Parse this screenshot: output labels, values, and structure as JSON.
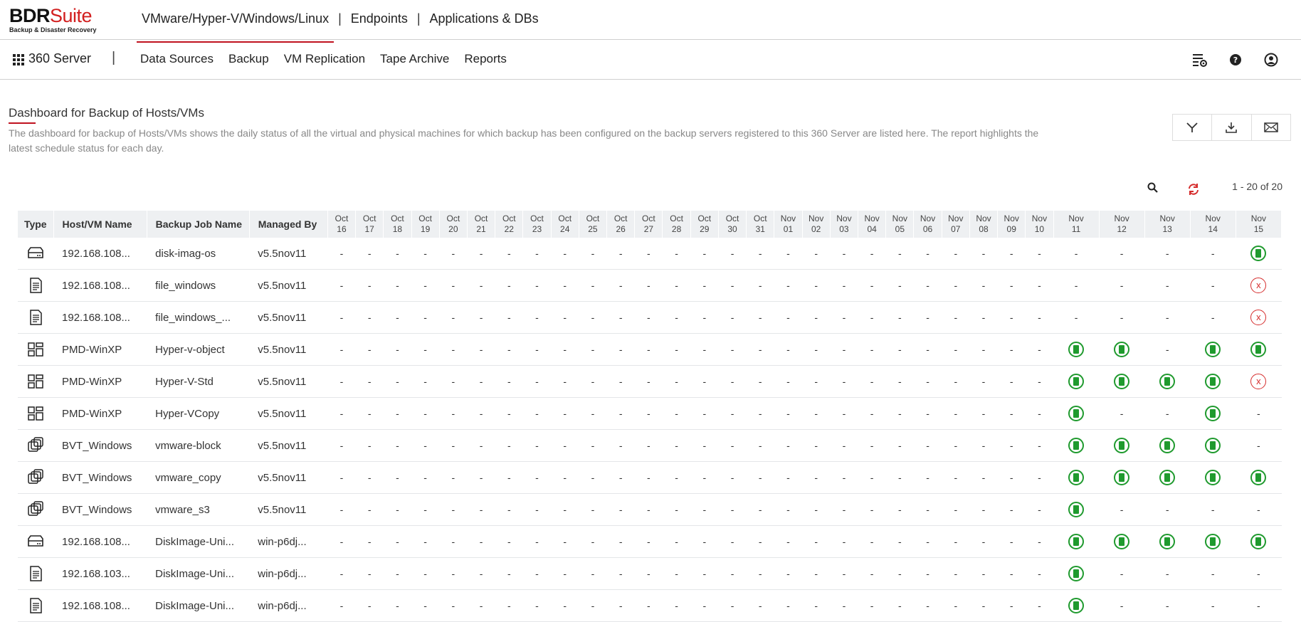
{
  "brand": {
    "name_bold": "BDR",
    "name_accent": "Suite",
    "tagline": "Backup & Disaster Recovery",
    "accent_color": "#c0121f"
  },
  "product_nav": {
    "items": [
      "VMware/Hyper-V/Windows/Linux",
      "Endpoints",
      "Applications & DBs"
    ],
    "active": 0
  },
  "menubar": {
    "product": "360 Server",
    "separator": "|",
    "items": [
      "Data Sources",
      "Backup",
      "VM Replication",
      "Tape Archive",
      "Reports"
    ],
    "icons": [
      "settings-list-icon",
      "help-icon",
      "user-icon"
    ]
  },
  "page": {
    "title": "Dashboard for Backup of Hosts/VMs",
    "description": "The dashboard for backup of Hosts/VMs shows the daily status of all the virtual and physical machines for which backup has been configured on the backup servers registered to this 360 Server are listed here. The report highlights the latest schedule status for each day.",
    "actions": [
      "filter-icon",
      "download-icon",
      "email-icon"
    ],
    "pager": "1 - 20 of 20"
  },
  "status_colors": {
    "success": "#1f9a2e",
    "failed": "#d52b2b"
  },
  "table": {
    "headers": {
      "type": "Type",
      "host": "Host/VM Name",
      "job": "Backup Job Name",
      "managed": "Managed By"
    },
    "dates": [
      [
        "Oct",
        "16"
      ],
      [
        "Oct",
        "17"
      ],
      [
        "Oct",
        "18"
      ],
      [
        "Oct",
        "19"
      ],
      [
        "Oct",
        "20"
      ],
      [
        "Oct",
        "21"
      ],
      [
        "Oct",
        "22"
      ],
      [
        "Oct",
        "23"
      ],
      [
        "Oct",
        "24"
      ],
      [
        "Oct",
        "25"
      ],
      [
        "Oct",
        "26"
      ],
      [
        "Oct",
        "27"
      ],
      [
        "Oct",
        "28"
      ],
      [
        "Oct",
        "29"
      ],
      [
        "Oct",
        "30"
      ],
      [
        "Oct",
        "31"
      ],
      [
        "Nov",
        "01"
      ],
      [
        "Nov",
        "02"
      ],
      [
        "Nov",
        "03"
      ],
      [
        "Nov",
        "04"
      ],
      [
        "Nov",
        "05"
      ],
      [
        "Nov",
        "06"
      ],
      [
        "Nov",
        "07"
      ],
      [
        "Nov",
        "08"
      ],
      [
        "Nov",
        "09"
      ],
      [
        "Nov",
        "10"
      ],
      [
        "Nov",
        "11"
      ],
      [
        "Nov",
        "12"
      ],
      [
        "Nov",
        "13"
      ],
      [
        "Nov",
        "14"
      ],
      [
        "Nov",
        "15"
      ]
    ],
    "rows": [
      {
        "type": "disk",
        "host": "192.168.108...",
        "job": "disk-imag-os",
        "managed": "v5.5nov11",
        "last5": [
          "-",
          "-",
          "-",
          "-",
          "ok"
        ]
      },
      {
        "type": "file",
        "host": "192.168.108...",
        "job": "file_windows",
        "managed": "v5.5nov11",
        "last5": [
          "-",
          "-",
          "-",
          "-",
          "fail"
        ]
      },
      {
        "type": "file",
        "host": "192.168.108...",
        "job": "file_windows_...",
        "managed": "v5.5nov11",
        "last5": [
          "-",
          "-",
          "-",
          "-",
          "fail"
        ]
      },
      {
        "type": "hyperv",
        "host": "PMD-WinXP",
        "job": "Hyper-v-object",
        "managed": "v5.5nov11",
        "last5": [
          "ok",
          "ok",
          "-",
          "ok",
          "ok"
        ]
      },
      {
        "type": "hyperv",
        "host": "PMD-WinXP",
        "job": "Hyper-V-Std",
        "managed": "v5.5nov11",
        "last5": [
          "ok",
          "ok",
          "ok",
          "ok",
          "fail"
        ]
      },
      {
        "type": "hyperv",
        "host": "PMD-WinXP",
        "job": "Hyper-VCopy",
        "managed": "v5.5nov11",
        "last5": [
          "ok",
          "-",
          "-",
          "ok",
          "-"
        ]
      },
      {
        "type": "vmware",
        "host": "BVT_Windows",
        "job": "vmware-block",
        "managed": "v5.5nov11",
        "last5": [
          "ok",
          "ok",
          "ok",
          "ok",
          "-"
        ]
      },
      {
        "type": "vmware",
        "host": "BVT_Windows",
        "job": "vmware_copy",
        "managed": "v5.5nov11",
        "last5": [
          "ok",
          "ok",
          "ok",
          "ok",
          "ok"
        ]
      },
      {
        "type": "vmware",
        "host": "BVT_Windows",
        "job": "vmware_s3",
        "managed": "v5.5nov11",
        "last5": [
          "ok",
          "-",
          "-",
          "-",
          "-"
        ]
      },
      {
        "type": "disk",
        "host": "192.168.108...",
        "job": "DiskImage-Uni...",
        "managed": "win-p6dj...",
        "last5": [
          "ok",
          "ok",
          "ok",
          "ok",
          "ok"
        ]
      },
      {
        "type": "file",
        "host": "192.168.103...",
        "job": "DiskImage-Uni...",
        "managed": "win-p6dj...",
        "last5": [
          "ok",
          "-",
          "-",
          "-",
          "-"
        ]
      },
      {
        "type": "file",
        "host": "192.168.108...",
        "job": "DiskImage-Uni...",
        "managed": "win-p6dj...",
        "last5": [
          "ok",
          "-",
          "-",
          "-",
          "-"
        ]
      }
    ]
  }
}
